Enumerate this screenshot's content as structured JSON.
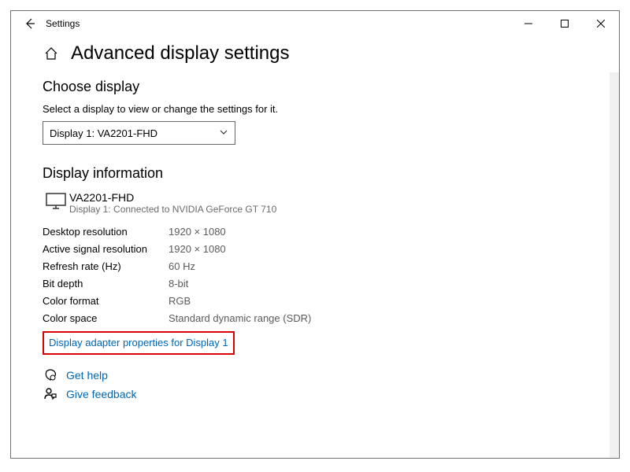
{
  "window": {
    "title": "Settings"
  },
  "page": {
    "title": "Advanced display settings"
  },
  "choose": {
    "heading": "Choose display",
    "desc": "Select a display to view or change the settings for it.",
    "selected": "Display 1: VA2201-FHD"
  },
  "info": {
    "heading": "Display information",
    "monitor_name": "VA2201-FHD",
    "monitor_sub": "Display 1: Connected to NVIDIA GeForce GT 710",
    "rows": [
      {
        "key": "Desktop resolution",
        "val": "1920 × 1080"
      },
      {
        "key": "Active signal resolution",
        "val": "1920 × 1080"
      },
      {
        "key": "Refresh rate (Hz)",
        "val": "60 Hz"
      },
      {
        "key": "Bit depth",
        "val": "8-bit"
      },
      {
        "key": "Color format",
        "val": "RGB"
      },
      {
        "key": "Color space",
        "val": "Standard dynamic range (SDR)"
      }
    ],
    "adapter_link": "Display adapter properties for Display 1"
  },
  "footer": {
    "help": "Get help",
    "feedback": "Give feedback"
  }
}
